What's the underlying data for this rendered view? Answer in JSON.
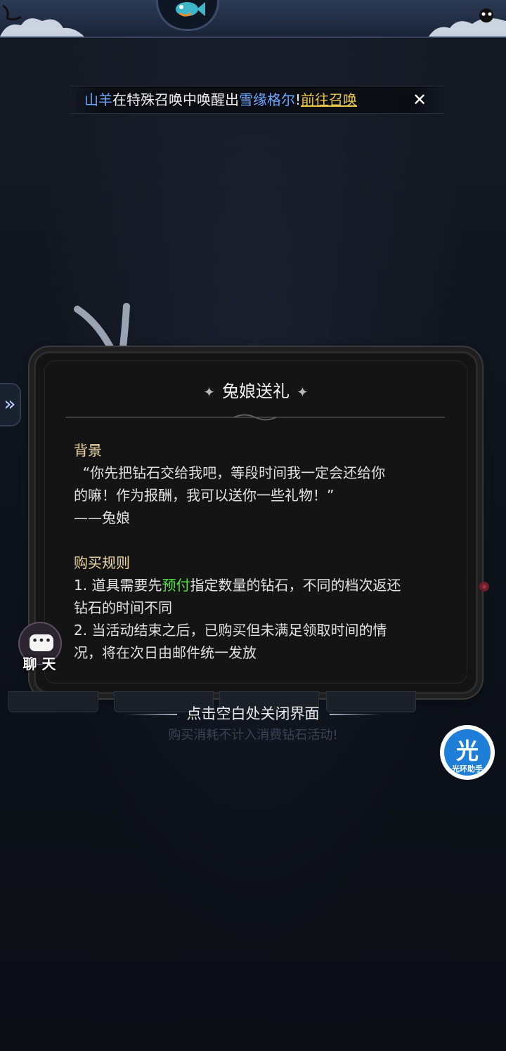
{
  "marquee": {
    "name": "山羊",
    "text1": "在特殊召唤中唤醒出",
    "hero": "雪缘格尔",
    "excl": "!",
    "link": "前往召唤",
    "close_icon": "✕"
  },
  "left_tab": {
    "icon": "»"
  },
  "dialog": {
    "title": "兔娘送礼",
    "title_deco": "✦",
    "background_heading": "背景",
    "background_line1": "“你先把钻石交给我吧，等段时间我一定会还给你",
    "background_line2": "的嘛！作为报酬，我可以送你一些礼物！”",
    "background_line3": "——兔娘",
    "rules_heading": "购买规则",
    "rule1_prefix": "1. 道具需要先",
    "rule1_highlight": "预付",
    "rule1_suffix": "指定数量的钻石，不同的档次返还",
    "rule1_line2": "钻石的时间不同",
    "rule2_line1": "2. 当活动结束之后，已购买但未满足领取时间的情",
    "rule2_line2": "况，将在次日由邮件统一发放"
  },
  "chat": {
    "label": "聊 天",
    "dots": "•••"
  },
  "hints": {
    "close": "点击空白处关闭界面",
    "sub": "购买消耗不计入消费钻石活动!"
  },
  "assistant": {
    "char": "光",
    "label": "光环助手"
  },
  "colors": {
    "accent_blue": "#6fa8ff",
    "link_gold": "#e8c84a",
    "highlight_green": "#58e04a",
    "heading_gold": "#eed9a8"
  }
}
